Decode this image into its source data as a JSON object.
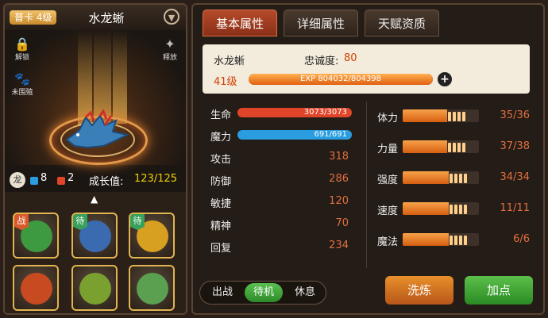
{
  "pet": {
    "tier_badge": "普卡 4级",
    "name": "水龙蜥",
    "unlock_label": "解锁",
    "release_label": "释放",
    "unwatched_label": "未围殖",
    "blue_count": "8",
    "red_count": "2",
    "growth_label": "成长值:",
    "growth_value": "123/125"
  },
  "tabs": [
    {
      "label": "基本属性"
    },
    {
      "label": "详细属性"
    },
    {
      "label": "天赋资质"
    }
  ],
  "info": {
    "name": "水龙蜥",
    "loyalty_label": "忠诚度:",
    "loyalty_value": "80",
    "level": "41级",
    "exp_text": "EXP 804032/804398",
    "exp_progress": 0.9995
  },
  "stats": [
    {
      "label": "生命",
      "bar": "3073/3073",
      "progress": 1.0,
      "color": "#e0452a"
    },
    {
      "label": "魔力",
      "bar": "691/691",
      "progress": 1.0,
      "color": "#2a9de0"
    },
    {
      "label": "攻击",
      "value": "318"
    },
    {
      "label": "防御",
      "value": "286"
    },
    {
      "label": "敏捷",
      "value": "120"
    },
    {
      "label": "精神",
      "value": "70"
    },
    {
      "label": "回复",
      "value": "234"
    }
  ],
  "aptitudes": [
    {
      "label": "体力",
      "value": "35/36",
      "progress": 0.972
    },
    {
      "label": "力量",
      "value": "37/38",
      "progress": 0.974
    },
    {
      "label": "强度",
      "value": "34/34",
      "progress": 1.0
    },
    {
      "label": "速度",
      "value": "11/11",
      "progress": 1.0
    },
    {
      "label": "魔法",
      "value": "6/6",
      "progress": 1.0
    }
  ],
  "status_buttons": [
    {
      "label": "出战",
      "active": false
    },
    {
      "label": "待机",
      "active": true
    },
    {
      "label": "休息",
      "active": false
    }
  ],
  "actions": {
    "reset_label": "洗炼",
    "add_points_label": "加点"
  },
  "slots": [
    {
      "tag": "战",
      "color": "#3d9a40"
    },
    {
      "tag": "待",
      "color": "#3a6ab0"
    },
    {
      "tag": "待",
      "color": "#d8a020"
    },
    {
      "tag": "",
      "color": "#c84a20"
    },
    {
      "tag": "",
      "color": "#7aa030"
    },
    {
      "tag": "",
      "color": "#5aa050"
    }
  ],
  "colors": {
    "accent": "#e07040",
    "active_tab": "#9e3d20",
    "primary_button": "#d0701a",
    "secondary_button": "#3a9a30"
  }
}
